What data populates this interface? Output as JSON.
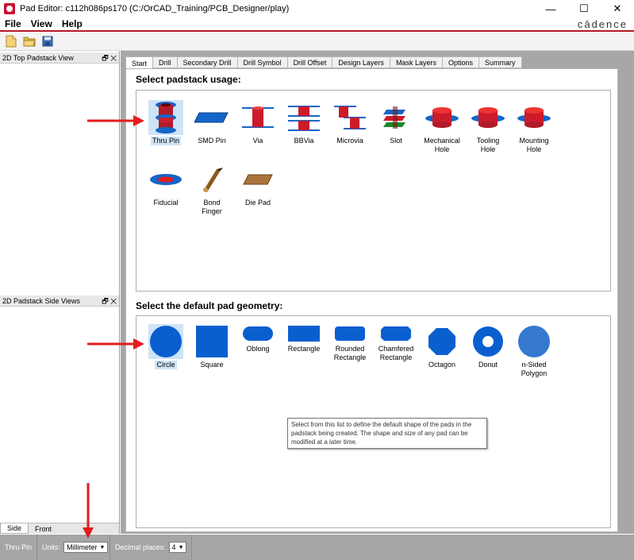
{
  "window": {
    "title": "Pad Editor: c112h086ps170  (C:/OrCAD_Training/PCB_Designer/play)",
    "minimize": "—",
    "maximize": "☐",
    "close": "✕"
  },
  "menu": {
    "file": "File",
    "view": "View",
    "help": "Help",
    "brand": "cādence"
  },
  "left": {
    "top_panel_title": "2D Top Padstack View",
    "side_panel_title": "2D Padstack Side Views",
    "panel_controls": "🗗 ✕",
    "tabs": [
      "Side",
      "Front"
    ]
  },
  "tabs": [
    "Start",
    "Drill",
    "Secondary Drill",
    "Drill Symbol",
    "Drill Offset",
    "Design Layers",
    "Mask Layers",
    "Options",
    "Summary"
  ],
  "usage": {
    "title": "Select padstack usage:",
    "items": [
      {
        "label": "Thru Pin",
        "icon": "thru-pin-icon"
      },
      {
        "label": "SMD Pin",
        "icon": "smd-pin-icon"
      },
      {
        "label": "Via",
        "icon": "via-icon"
      },
      {
        "label": "BBVia",
        "icon": "bbvia-icon"
      },
      {
        "label": "Microvia",
        "icon": "microvia-icon"
      },
      {
        "label": "Slot",
        "icon": "slot-icon"
      },
      {
        "label": "Mechanical\nHole",
        "icon": "mechanical-hole-icon"
      },
      {
        "label": "Tooling\nHole",
        "icon": "tooling-hole-icon"
      },
      {
        "label": "Mounting\nHole",
        "icon": "mounting-hole-icon"
      },
      {
        "label": "Fiducial",
        "icon": "fiducial-icon"
      },
      {
        "label": "Bond\nFinger",
        "icon": "bond-finger-icon"
      },
      {
        "label": "Die Pad",
        "icon": "die-pad-icon"
      }
    ],
    "selected": "Thru Pin"
  },
  "geometry": {
    "title": "Select the default pad geometry:",
    "items": [
      {
        "label": "Circle",
        "icon": "circle-icon"
      },
      {
        "label": "Square",
        "icon": "square-icon"
      },
      {
        "label": "Oblong",
        "icon": "oblong-icon"
      },
      {
        "label": "Rectangle",
        "icon": "rectangle-icon"
      },
      {
        "label": "Rounded\nRectangle",
        "icon": "rounded-rectangle-icon"
      },
      {
        "label": "Chamfered\nRectangle",
        "icon": "chamfered-rectangle-icon"
      },
      {
        "label": "Octagon",
        "icon": "octagon-icon"
      },
      {
        "label": "Donut",
        "icon": "donut-icon"
      },
      {
        "label": "n-Sided\nPolygon",
        "icon": "polygon-icon"
      }
    ],
    "selected": "Circle",
    "tooltip": "Select from this list to define the default shape of the pads in the padstack being created. The shape and size of any pad can be modified at a later time."
  },
  "status": {
    "usage": "Thru Pin",
    "units_label": "Units:",
    "units_value": "Millimeter",
    "decimal_label": "Decimal places:",
    "decimal_value": "4"
  },
  "colors": {
    "accent_red": "#e31d1d",
    "pad_blue": "#1565c8",
    "drill_red": "#cc1b2a",
    "selection": "#cde4f7"
  }
}
